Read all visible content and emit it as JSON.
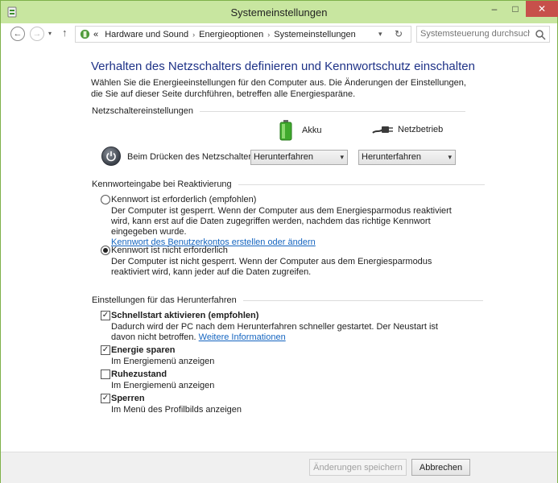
{
  "window": {
    "title": "Systemeinstellungen",
    "minimize": "–",
    "maximize": "□",
    "close": "✕"
  },
  "nav": {
    "back": "←",
    "forward": "→",
    "history": "▾",
    "up": "↑",
    "crumb_prefix": "«",
    "breadcrumbs": [
      "Hardware und Sound",
      "Energieoptionen",
      "Systemeinstellungen"
    ],
    "crumb_separator": "›",
    "address_dropdown": "▾",
    "refresh": "↻",
    "search_placeholder": "Systemsteuerung durchsuchen"
  },
  "page": {
    "title": "Verhalten des Netzschalters definieren und Kennwortschutz einschalten",
    "intro": "Wählen Sie die Energieeinstellungen für den Computer aus. Die Änderungen der Einstellungen, die Sie auf dieser Seite durchführen, betreffen alle Energiesparäne."
  },
  "power_section": {
    "header": "Netzschaltereinstellungen",
    "col_battery": "Akku",
    "col_ac": "Netzbetrieb",
    "row_label": "Beim Drücken des Netzschalters:",
    "battery_value": "Herunterfahren",
    "ac_value": "Herunterfahren",
    "dropdown_arrow": "▾"
  },
  "password_section": {
    "header": "Kennworteingabe bei Reaktivierung",
    "options": [
      {
        "label": "Kennwort ist erforderlich (empfohlen)",
        "desc": "Der Computer ist gesperrt. Wenn der Computer aus dem Energiesparmodus reaktiviert wird, kann erst auf die Daten zugegriffen werden, nachdem das richtige Kennwort eingegeben wurde.",
        "link": "Kennwort des Benutzerkontos erstellen oder ändern",
        "checked": false
      },
      {
        "label": "Kennwort ist nicht erforderlich",
        "desc": "Der Computer ist nicht gesperrt. Wenn der Computer aus dem Energiesparmodus reaktiviert wird, kann jeder auf die Daten zugreifen.",
        "checked": true
      }
    ]
  },
  "shutdown_section": {
    "header": "Einstellungen für das Herunterfahren",
    "check_mark": "✓",
    "items": [
      {
        "label": "Schnellstart aktivieren (empfohlen)",
        "desc": "Dadurch wird der PC nach dem Herunterfahren schneller gestartet. Der Neustart ist davon nicht betroffen.",
        "link": "Weitere Informationen",
        "checked": true
      },
      {
        "label": "Energie sparen",
        "desc": "Im Energiemenü anzeigen",
        "checked": true
      },
      {
        "label": "Ruhezustand",
        "desc": "Im Energiemenü anzeigen",
        "checked": false
      },
      {
        "label": "Sperren",
        "desc": "Im Menü des Profilbilds anzeigen",
        "checked": true
      }
    ]
  },
  "footer": {
    "save_label": "Änderungen speichern",
    "cancel_label": "Abbrechen"
  },
  "colors": {
    "titlebar": "#c8e6a0",
    "heading": "#1e3287",
    "link": "#1565c0",
    "close_button": "#c7504b"
  }
}
